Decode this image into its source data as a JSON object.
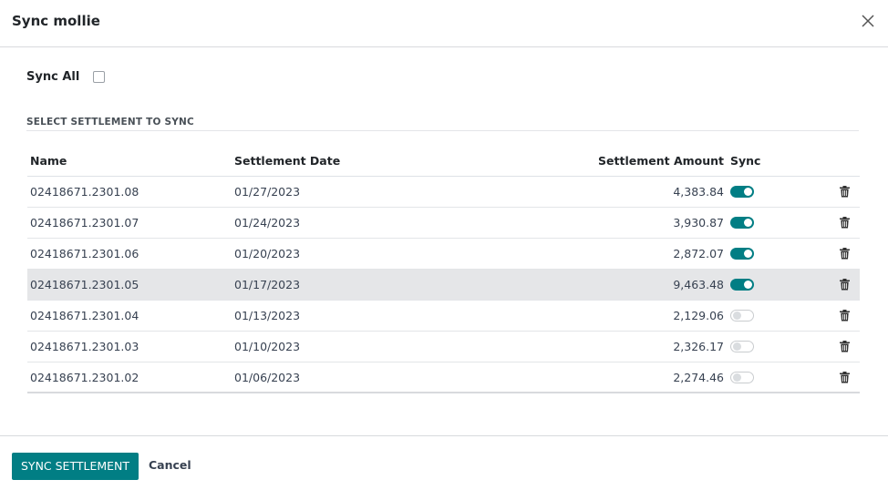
{
  "dialog": {
    "title": "Sync mollie"
  },
  "sync_all": {
    "label": "Sync All",
    "checked": false
  },
  "section": {
    "title": "SELECT SETTLEMENT TO SYNC"
  },
  "table": {
    "headers": {
      "name": "Name",
      "date": "Settlement Date",
      "amount": "Settlement Amount",
      "sync": "Sync"
    },
    "rows": [
      {
        "name": "02418671.2301.08",
        "date": "01/27/2023",
        "amount": "4,383.84",
        "sync": true
      },
      {
        "name": "02418671.2301.07",
        "date": "01/24/2023",
        "amount": "3,930.87",
        "sync": true
      },
      {
        "name": "02418671.2301.06",
        "date": "01/20/2023",
        "amount": "2,872.07",
        "sync": true
      },
      {
        "name": "02418671.2301.05",
        "date": "01/17/2023",
        "amount": "9,463.48",
        "sync": true
      },
      {
        "name": "02418671.2301.04",
        "date": "01/13/2023",
        "amount": "2,129.06",
        "sync": false
      },
      {
        "name": "02418671.2301.03",
        "date": "01/10/2023",
        "amount": "2,326.17",
        "sync": false
      },
      {
        "name": "02418671.2301.02",
        "date": "01/06/2023",
        "amount": "2,274.46",
        "sync": false
      }
    ]
  },
  "footer": {
    "primary_label": "SYNC SETTLEMENT",
    "cancel_label": "Cancel"
  },
  "colors": {
    "accent": "#017e84",
    "row_highlight": "#e5e6e8"
  },
  "icons": {
    "close": "close-icon",
    "delete": "trash-icon"
  }
}
